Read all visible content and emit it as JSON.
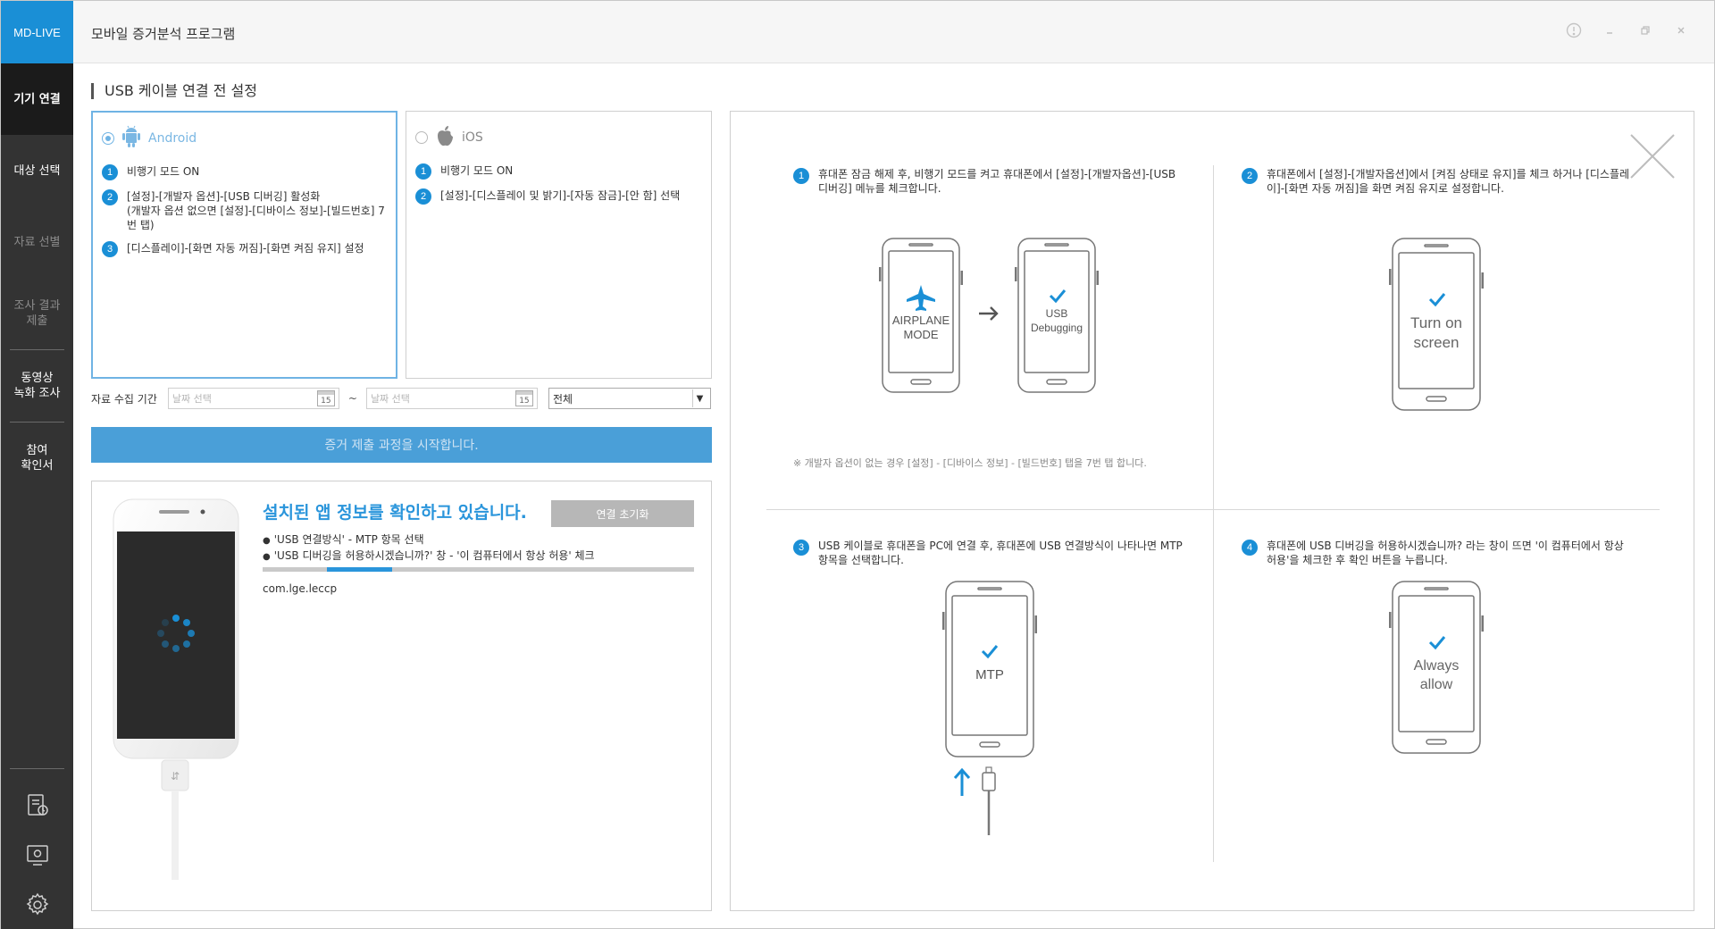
{
  "app": {
    "brand": "MD-LIVE",
    "title": "모바일 증거분석 프로그램"
  },
  "sidebar": {
    "items": [
      {
        "label": "기기 연결"
      },
      {
        "label": "대상 선택"
      },
      {
        "label": "자료 선별"
      },
      {
        "label": "조사 결과\n제출"
      },
      {
        "label": "동영상\n녹화 조사"
      },
      {
        "label": "참여\n확인서"
      }
    ]
  },
  "section": {
    "title": "USB 케이블 연결 전 설정"
  },
  "android": {
    "name": "Android",
    "steps": [
      {
        "num": "1",
        "text": "비행기 모드 ON"
      },
      {
        "num": "2",
        "text": "[설정]-[개발자 옵션]-[USB 디버깅] 활성화\n(개발자 옵션 없으면 [설정]-[디바이스 정보]-[빌드번호] 7번 탭)"
      },
      {
        "num": "3",
        "text": "[디스플레이]-[화면 자동 꺼짐]-[화면 켜짐 유지] 설정"
      }
    ]
  },
  "ios": {
    "name": "iOS",
    "steps": [
      {
        "num": "1",
        "text": "비행기 모드 ON"
      },
      {
        "num": "2",
        "text": "[설정]-[디스플레이 및 밝기]-[자동 잠금]-[안 함] 선택"
      }
    ]
  },
  "date_filter": {
    "label": "자료 수집 기간",
    "from_placeholder": "날짜 선택",
    "to_placeholder": "날짜 선택",
    "calendar_day": "15",
    "separator": "~",
    "scope": "전체"
  },
  "start_button": "증거 제출 과정을 시작합니다.",
  "progress": {
    "title": "설치된 앱 정보를 확인하고 있습니다.",
    "reset_button": "연결 초기화",
    "bullets": [
      "'USB 연결방식' - MTP 항목 선택",
      "'USB 디버깅을 허용하시겠습니까?' 창 - '이 컴퓨터에서 항상 허용' 체크"
    ],
    "bar_start": 0.15,
    "bar_end": 0.3,
    "package": "com.lge.leccp"
  },
  "guide": {
    "steps": [
      {
        "num": "1",
        "text": "휴대폰 잠금 해제 후, 비행기 모드를 켜고 휴대폰에서 [설정]-[개발자옵션]-[USB 디버깅] 메뉴를 체크합니다."
      },
      {
        "num": "2",
        "text": "휴대폰에서 [설정]-[개발자옵션]에서 [켜짐 상태로 유지]를 체크 하거나 [디스플레이]-[화면 자동 꺼짐]을 화면 켜짐 유지로 설정합니다."
      },
      {
        "num": "3",
        "text": "USB 케이블로 휴대폰을 PC에 연결 후, 휴대폰에 USB 연결방식이 나타나면 MTP 항목을 선택합니다."
      },
      {
        "num": "4",
        "text": "휴대폰에 USB 디버깅을 허용하시겠습니까? 라는 창이 뜨면 '이 컴퓨터에서 항상 허용'을 체크한 후 확인 버튼을 누릅니다."
      }
    ],
    "note": "※ 개발자 옵션이 없는 경우 [설정] - [디바이스 정보] - [빌드번호] 탭을 7번 탭 합니다.",
    "phones": {
      "airplane": [
        "AIRPLANE",
        "MODE"
      ],
      "usb": [
        "USB",
        "Debugging"
      ],
      "screen": [
        "Turn on",
        "screen"
      ],
      "mtp": "MTP",
      "always": [
        "Always",
        "allow"
      ]
    }
  },
  "colors": {
    "accent": "#1a8fd6",
    "sidebar": "#333333",
    "sidebar_active": "#1b1b1b",
    "button": "#4a9fd8"
  }
}
